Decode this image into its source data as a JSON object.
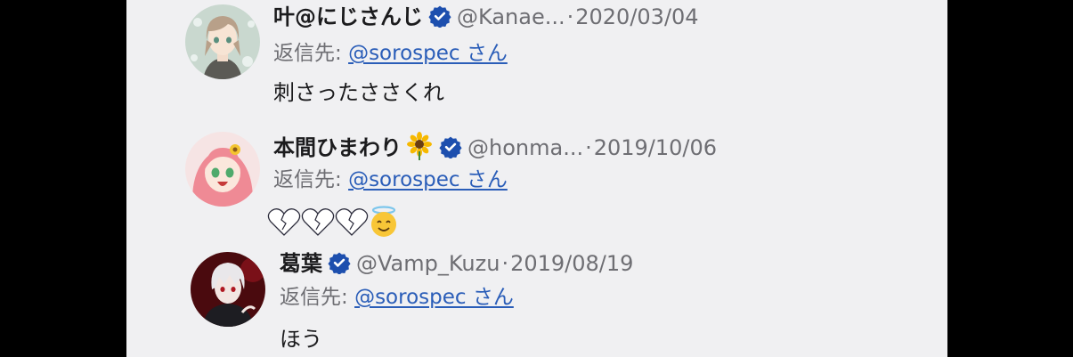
{
  "tweets": [
    {
      "name": "叶@にじさんじ",
      "handle": "@Kanae...",
      "separator": "·",
      "date": "2020/03/04",
      "reply_prefix": "返信先:",
      "reply_target": "@sorospec さん",
      "text": "刺さったささくれ",
      "avatar_icon": "kanae-avatar-icon"
    },
    {
      "name": "本間ひまわり",
      "name_emoji": "sunflower-icon",
      "handle": "@honma...",
      "separator": "·",
      "date": "2019/10/06",
      "reply_prefix": "返信先:",
      "reply_target": "@sorospec さん",
      "text_icons": [
        "broken-heart-icon",
        "broken-heart-icon",
        "broken-heart-icon",
        "angel-face-icon"
      ],
      "avatar_icon": "himawari-avatar-icon"
    },
    {
      "name": "葛葉",
      "handle": "@Vamp_Kuzu",
      "separator": "·",
      "date": "2019/08/19",
      "reply_prefix": "返信先:",
      "reply_target": "@sorospec さん",
      "text": "ほう",
      "avatar_icon": "kuzuha-avatar-icon"
    }
  ],
  "colors": {
    "background": "#f0f0f2",
    "link": "#2a5db8",
    "verified": "#1d4fae",
    "muted": "#6e6e73"
  }
}
